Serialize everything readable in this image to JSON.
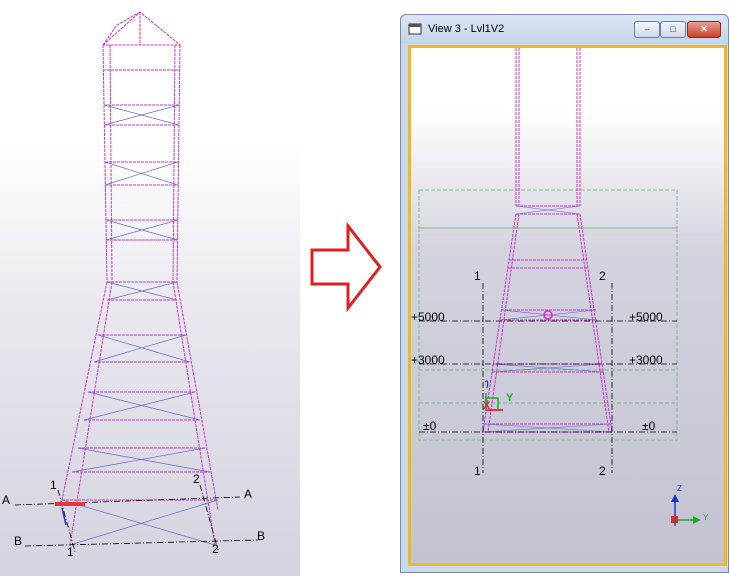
{
  "window": {
    "title": "View 3 - Lvl1V2",
    "controls": {
      "minimize": "–",
      "maximize": "□",
      "close": "✕"
    }
  },
  "left_view": {
    "grid_lines": {
      "A": "A",
      "B": "B"
    },
    "grid_numbers": {
      "one": "1",
      "two": "2"
    }
  },
  "right_view": {
    "grid_numbers": {
      "one": "1",
      "two": "2"
    },
    "levels": {
      "l5000": "+5000",
      "l3000": "+3000",
      "l0": "±0"
    },
    "ucs": {
      "x": "X",
      "y": "Y"
    },
    "axis_triad": {
      "z": "Z",
      "y": "Y"
    }
  },
  "colors": {
    "member": "#cc33cc",
    "brace": "#6666cc",
    "frame_border": "#f4b81c",
    "close_button": "#c8422a"
  }
}
